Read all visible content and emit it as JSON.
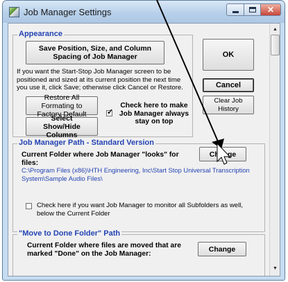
{
  "window": {
    "title": "Job Manager Settings"
  },
  "appearance": {
    "legend": "Appearance",
    "save_button": "Save Position, Size, and Column Spacing of Job Manager",
    "save_help": "If you want the  Start-Stop Job Manager screen to be positioned and sized at its current position the next time you use it, click Save; otherwise click Cancel or Restore.",
    "restore_button": "Restore All Formating to Factory Default",
    "show_hide_button": "Select Show/Hide Columns",
    "always_on_top_label": "Check here to make Job Manager always stay on top",
    "always_on_top_checked": true
  },
  "side": {
    "ok": "OK",
    "cancel": "Cancel",
    "clear_history": "Clear Job History"
  },
  "job_path": {
    "legend": "Job Manager Path - Standard Version",
    "label": "Current Folder where Job Manager \"looks\" for files:",
    "change_button": "Change",
    "path": "C:\\Program Files (x86)\\HTH Engineering, Inc\\Start Stop Universal Transcription System\\Sample Audio Files\\",
    "subfolders_label": "Check here if you want Job Manager to monitor all Subfolders as well, below the Current Folder",
    "subfolders_checked": false
  },
  "done_path": {
    "legend": "\"Move to Done Folder\"  Path",
    "label": "Current Folder where files are moved that are marked \"Done\" on the Job Manager:",
    "change_button": "Change"
  }
}
